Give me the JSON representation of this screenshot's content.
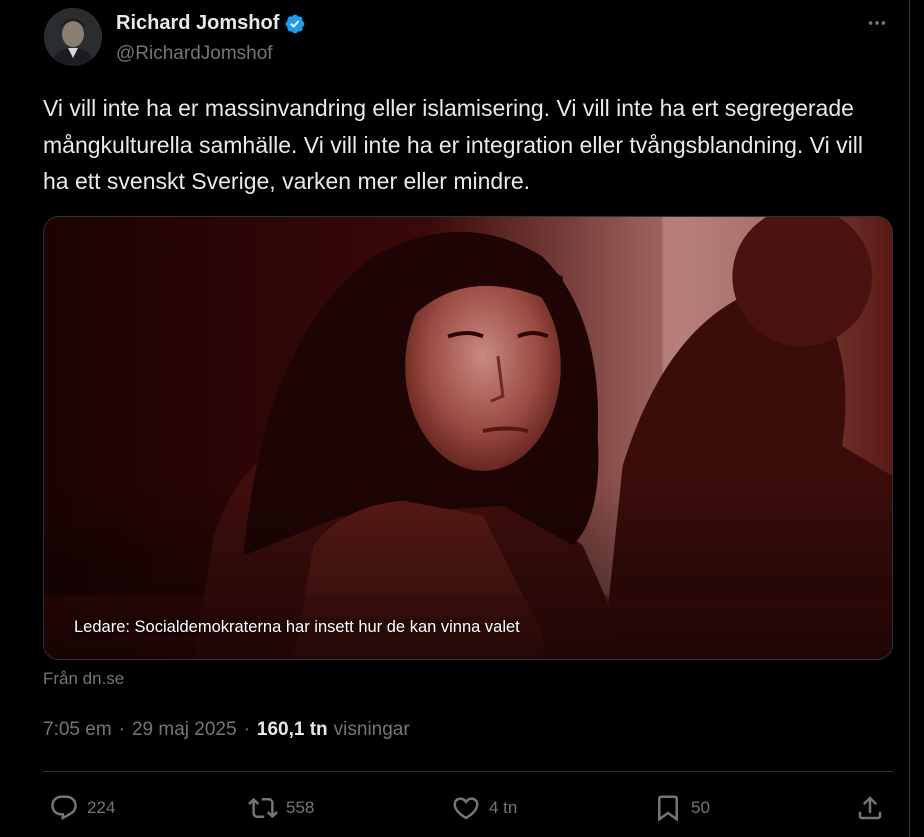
{
  "author": {
    "display_name": "Richard Jomshof",
    "handle": "@RichardJomshof",
    "verified": true
  },
  "tweet": {
    "text": "Vi vill inte ha er massinvandring eller islamisering. Vi vill inte ha ert segregerade mångkulturella samhälle. Vi vill inte ha er integration eller tvångsblandning. Vi vill ha ett svenskt Sverige, varken mer eller mindre."
  },
  "card": {
    "caption": "Ledare: Socialdemokraterna har insett hur de kan vinna valet",
    "source": "Från dn.se"
  },
  "meta": {
    "time": "7:05 em",
    "date": "29 maj 2025",
    "views_count": "160,1 tn",
    "views_label": "visningar",
    "separator": "·"
  },
  "actions": {
    "replies": "224",
    "reposts": "558",
    "likes": "4 tn",
    "bookmarks": "50"
  },
  "icons": {
    "verified": "verified-badge-icon",
    "more": "more-options-icon",
    "reply": "reply-icon",
    "repost": "repost-icon",
    "like": "heart-icon",
    "bookmark": "bookmark-icon",
    "share": "share-icon"
  },
  "colors": {
    "background": "#000000",
    "text_primary": "#e7e9ea",
    "text_secondary": "#71767b",
    "verified_blue": "#1d9bf0",
    "border": "#2f3336",
    "photo_tint": "#8b1a1a"
  }
}
